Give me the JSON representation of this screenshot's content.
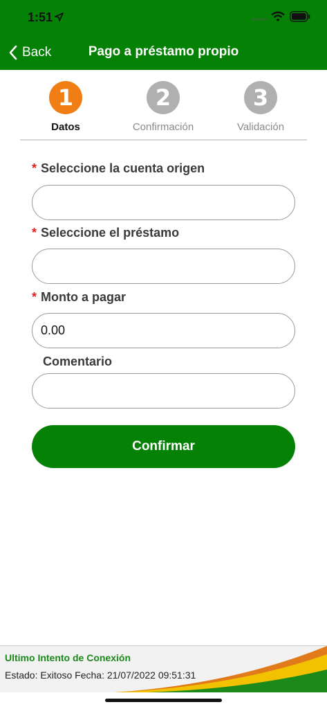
{
  "status_bar": {
    "time": "1:51"
  },
  "header": {
    "back_label": "Back",
    "title": "Pago a préstamo propio",
    "color": "#058205"
  },
  "steps": [
    {
      "number": "1",
      "label": "Datos",
      "active": true
    },
    {
      "number": "2",
      "label": "Confirmación",
      "active": false
    },
    {
      "number": "3",
      "label": "Validación",
      "active": false
    }
  ],
  "colors": {
    "step_active": "#F07E14",
    "step_inactive": "#B0B0B0",
    "required": "#E02020"
  },
  "form": {
    "required_mark": "*",
    "source_account": {
      "label": "Seleccione la cuenta origen",
      "value": ""
    },
    "loan": {
      "label": "Seleccione el préstamo",
      "value": ""
    },
    "amount": {
      "label": "Monto a pagar",
      "value": "0.00"
    },
    "comment": {
      "label": "Comentario",
      "value": ""
    },
    "confirm_label": "Confirmar"
  },
  "footer": {
    "title": "Ultimo Intento de Conexión",
    "status": "Estado: Exitoso  Fecha: 21/07/2022 09:51:31"
  }
}
